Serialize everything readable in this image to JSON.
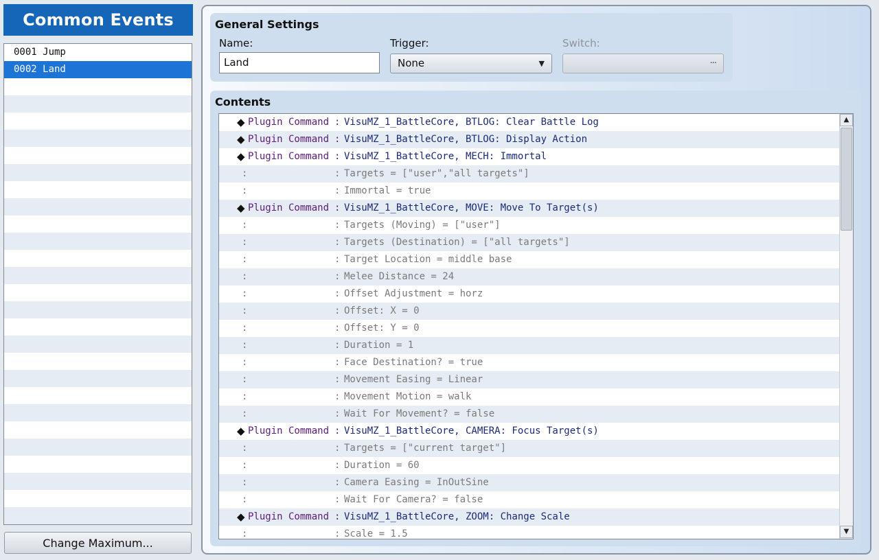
{
  "left": {
    "title": "Common Events",
    "events": [
      {
        "label": "0001 Jump",
        "selected": false
      },
      {
        "label": "0002 Land",
        "selected": true
      }
    ],
    "change_max_label": "Change Maximum..."
  },
  "general": {
    "title": "General Settings",
    "name_label": "Name:",
    "name_value": "Land",
    "trigger_label": "Trigger:",
    "trigger_value": "None",
    "switch_label": "Switch:",
    "switch_button": "..."
  },
  "contents": {
    "title": "Contents",
    "rows": [
      {
        "type": "cmd",
        "label": "Plugin Command",
        "text": "VisuMZ_1_BattleCore, BTLOG: Clear Battle Log"
      },
      {
        "type": "cmd",
        "label": "Plugin Command",
        "text": "VisuMZ_1_BattleCore, BTLOG: Display Action"
      },
      {
        "type": "cmd",
        "label": "Plugin Command",
        "text": "VisuMZ_1_BattleCore, MECH: Immortal"
      },
      {
        "type": "cont",
        "text": "Targets = [\"user\",\"all targets\"]"
      },
      {
        "type": "cont",
        "text": "Immortal = true"
      },
      {
        "type": "cmd",
        "label": "Plugin Command",
        "text": "VisuMZ_1_BattleCore, MOVE: Move To Target(s)"
      },
      {
        "type": "cont",
        "text": "Targets (Moving) = [\"user\"]"
      },
      {
        "type": "cont",
        "text": "Targets (Destination) = [\"all targets\"]"
      },
      {
        "type": "cont",
        "text": "Target Location = middle base"
      },
      {
        "type": "cont",
        "text": "Melee Distance = 24"
      },
      {
        "type": "cont",
        "text": "Offset Adjustment = horz"
      },
      {
        "type": "cont",
        "text": "Offset: X = 0"
      },
      {
        "type": "cont",
        "text": "Offset: Y = 0"
      },
      {
        "type": "cont",
        "text": "Duration = 1"
      },
      {
        "type": "cont",
        "text": "Face Destination? = true"
      },
      {
        "type": "cont",
        "text": "Movement Easing = Linear"
      },
      {
        "type": "cont",
        "text": "Movement Motion = walk"
      },
      {
        "type": "cont",
        "text": "Wait For Movement? = false"
      },
      {
        "type": "cmd",
        "label": "Plugin Command",
        "text": "VisuMZ_1_BattleCore, CAMERA: Focus Target(s)"
      },
      {
        "type": "cont",
        "text": "Targets = [\"current target\"]"
      },
      {
        "type": "cont",
        "text": "Duration = 60"
      },
      {
        "type": "cont",
        "text": "Camera Easing = InOutSine"
      },
      {
        "type": "cont",
        "text": "Wait For Camera? = false"
      },
      {
        "type": "cmd",
        "label": "Plugin Command",
        "text": "VisuMZ_1_BattleCore, ZOOM: Change Scale"
      },
      {
        "type": "cont",
        "text": "Scale = 1.5"
      }
    ]
  }
}
